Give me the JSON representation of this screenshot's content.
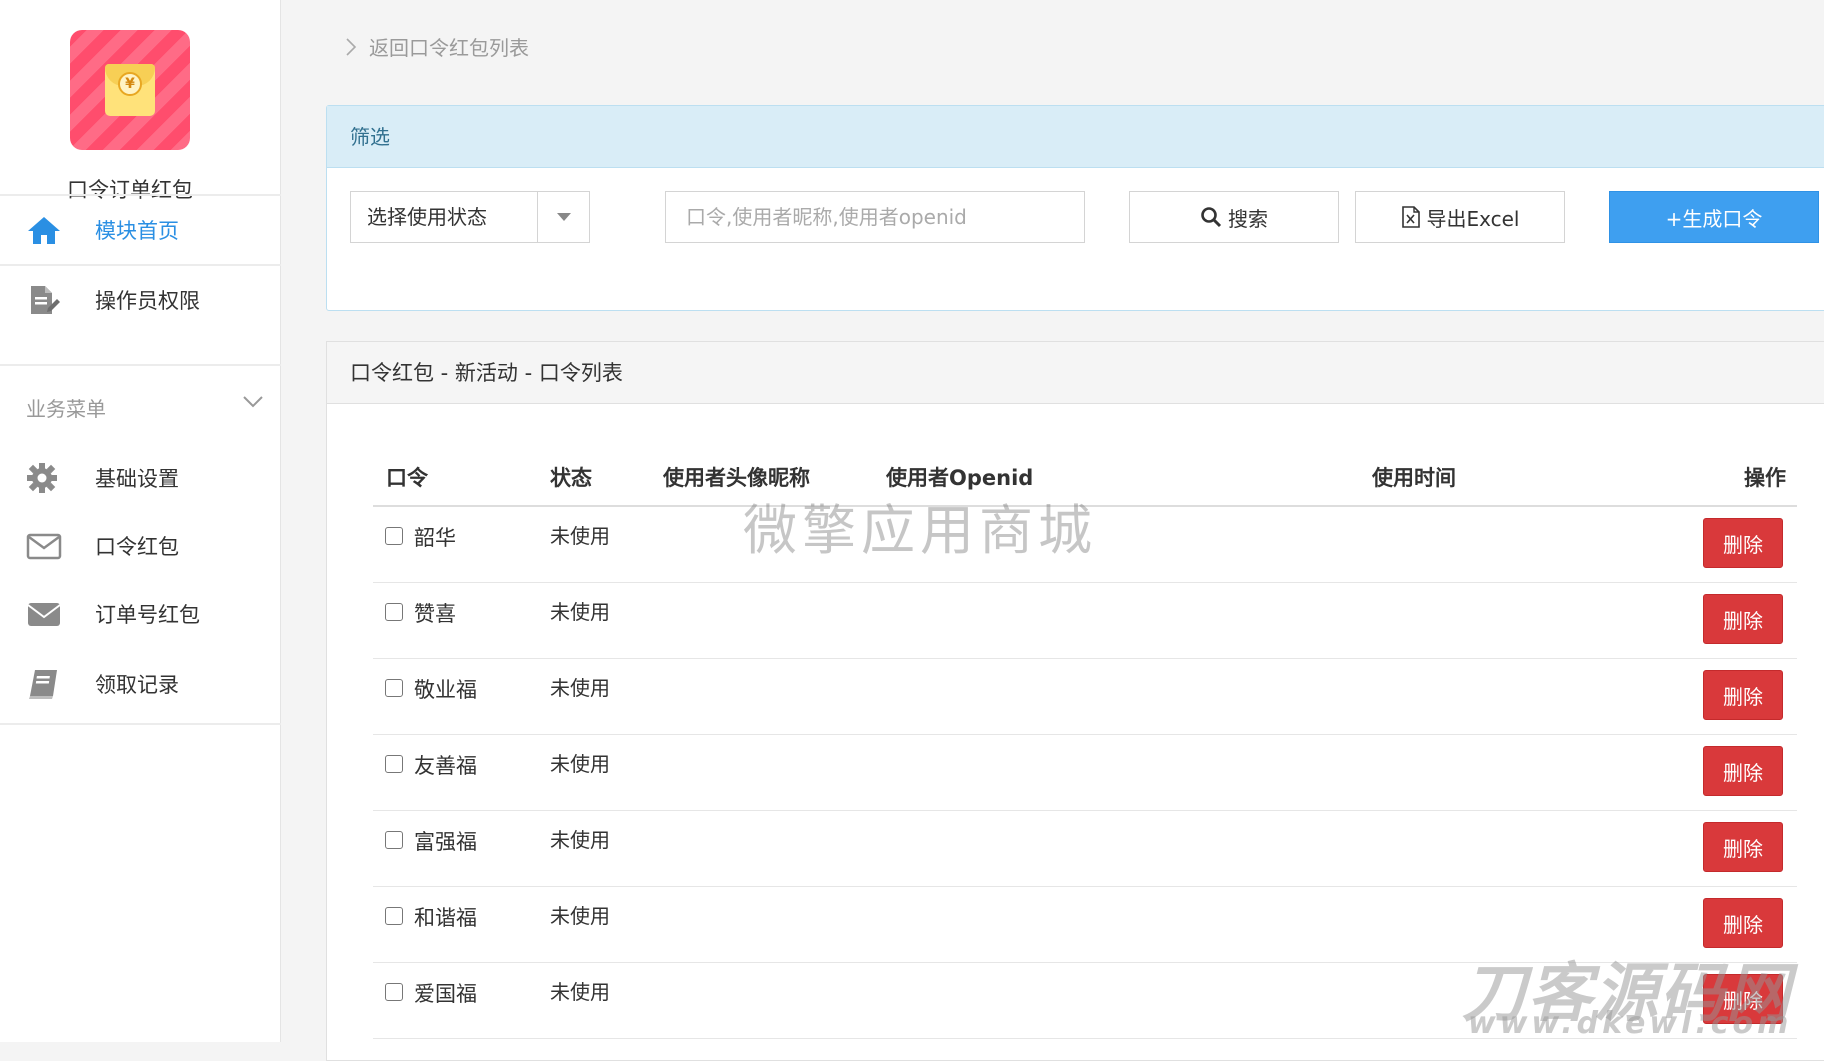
{
  "sidebar": {
    "app_name": "口令订单红包",
    "nav": [
      {
        "label": "模块首页",
        "icon": "home-icon",
        "active": true
      },
      {
        "label": "操作员权限",
        "icon": "document-edit-icon",
        "active": false
      }
    ],
    "section_title": "业务菜单",
    "menu": [
      {
        "label": "基础设置",
        "icon": "gear-icon"
      },
      {
        "label": "口令红包",
        "icon": "envelope-outline-icon"
      },
      {
        "label": "订单号红包",
        "icon": "envelope-solid-icon"
      },
      {
        "label": "领取记录",
        "icon": "book-icon"
      }
    ]
  },
  "breadcrumb": {
    "label": "返回口令红包列表"
  },
  "filter": {
    "title": "筛选",
    "status_select": "选择使用状态",
    "search_placeholder": "口令,使用者昵称,使用者openid",
    "search_button": "搜索",
    "export_button": "导出Excel",
    "generate_button": "+生成口令"
  },
  "list": {
    "title": "口令红包 - 新活动 - 口令列表",
    "columns": [
      "口令",
      "状态",
      "使用者头像昵称",
      "使用者Openid",
      "使用时间",
      "操作"
    ],
    "rows": [
      {
        "code": "韶华",
        "status": "未使用",
        "action": "删除"
      },
      {
        "code": "赞喜",
        "status": "未使用",
        "action": "删除"
      },
      {
        "code": "敬业福",
        "status": "未使用",
        "action": "删除"
      },
      {
        "code": "友善福",
        "status": "未使用",
        "action": "删除"
      },
      {
        "code": "富强福",
        "status": "未使用",
        "action": "删除"
      },
      {
        "code": "和谐福",
        "status": "未使用",
        "action": "删除"
      },
      {
        "code": "爱国福",
        "status": "未使用",
        "action": "删除"
      }
    ]
  },
  "watermarks": {
    "center": "微擎应用商城",
    "corner_main": "刀客源码网",
    "corner_url": "www.dkewl.com"
  },
  "colors": {
    "accent": "#2a8fe3",
    "primary_button": "#3e9ff0",
    "danger": "#d9393b",
    "filter_header": "#d9edf7"
  }
}
